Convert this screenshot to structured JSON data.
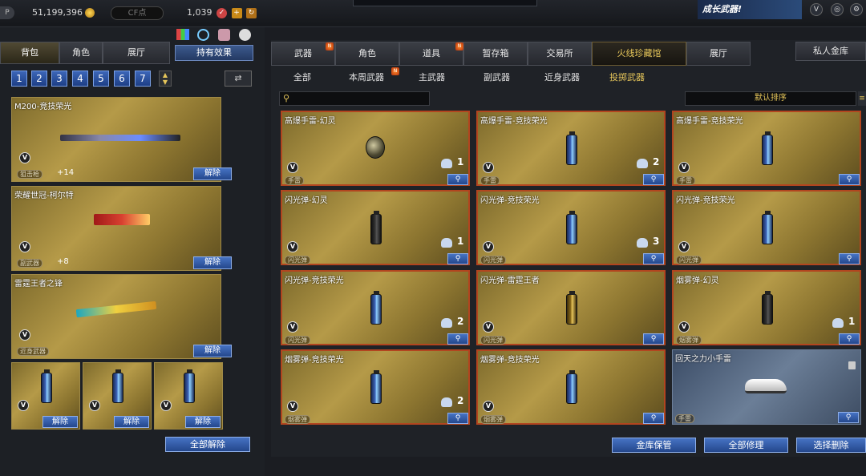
{
  "topbar": {
    "p_label": "P",
    "gp": "51,199,396",
    "cf_label": "CF点",
    "coins": "1,039",
    "ad_text": "成长武器!"
  },
  "left": {
    "tabs": [
      "背包",
      "角色",
      "展厅"
    ],
    "effect_btn": "持有效果",
    "pages": [
      "1",
      "2",
      "3",
      "4",
      "5",
      "6",
      "7"
    ],
    "items": [
      {
        "name": "M200-竞技荣光",
        "tag": "狙击枪",
        "plus": "+14",
        "btn": "解除"
      },
      {
        "name": "荣耀世冠-柯尔特",
        "tag": "副武器",
        "plus": "+8",
        "btn": "解除"
      },
      {
        "name": "雷霆王者之锋",
        "tag": "近身武器",
        "btn": "解除"
      }
    ],
    "small_btn": "解除",
    "release_all": "全部解除"
  },
  "right": {
    "tabs": [
      "武器",
      "角色",
      "道具",
      "暂存箱",
      "交易所",
      "火线珍藏馆",
      "展厅"
    ],
    "private_vault": "私人金库",
    "subtabs": [
      "全部",
      "本周武器",
      "主武器",
      "副武器",
      "近身武器",
      "投掷武器"
    ],
    "sort": "默认排序",
    "items": [
      {
        "name": "高爆手雷-幻灵",
        "tag": "手雷",
        "qty": "1",
        "style": "frag"
      },
      {
        "name": "高爆手雷-竞技荣光",
        "tag": "手雷",
        "qty": "2",
        "style": "can"
      },
      {
        "name": "高爆手雷-竞技荣光",
        "tag": "手雷",
        "qty": "",
        "style": "can"
      },
      {
        "name": "闪光弹-幻灵",
        "tag": "闪光弹",
        "qty": "1",
        "style": "dark"
      },
      {
        "name": "闪光弹-竞技荣光",
        "tag": "闪光弹",
        "qty": "3",
        "style": "can"
      },
      {
        "name": "闪光弹-竞技荣光",
        "tag": "闪光弹",
        "qty": "",
        "style": "can"
      },
      {
        "name": "闪光弹-竞技荣光",
        "tag": "闪光弹",
        "qty": "2",
        "style": "can"
      },
      {
        "name": "闪光弹-雷霆王者",
        "tag": "闪光弹",
        "qty": "",
        "style": "gold"
      },
      {
        "name": "烟雾弹-幻灵",
        "tag": "烟雾弹",
        "qty": "1",
        "style": "dark"
      },
      {
        "name": "烟雾弹-竞技荣光",
        "tag": "烟雾弹",
        "qty": "2",
        "style": "can"
      },
      {
        "name": "烟雾弹-竞技荣光",
        "tag": "烟雾弹",
        "qty": "",
        "style": "can"
      },
      {
        "name": "回天之力小手雷",
        "tag": "手雷",
        "qty": "",
        "style": "shoe"
      }
    ],
    "bottom_btns": [
      "金库保管",
      "全部修理",
      "选择删除"
    ]
  }
}
